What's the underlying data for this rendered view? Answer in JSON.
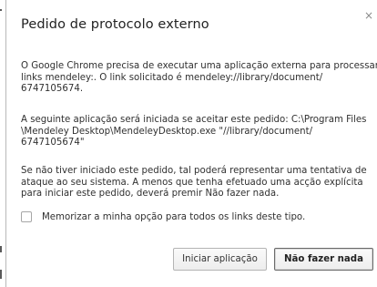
{
  "dialog": {
    "title": "Pedido de protocolo externo",
    "close_glyph": "×",
    "close_icon": "close-icon",
    "paragraph1": [
      "O Google Chrome precisa de executar uma aplicação externa para processar",
      "links mendeley:. O link solicitado é mendeley://library/document/",
      "6747105674."
    ],
    "paragraph2": [
      "A seguinte aplicação será iniciada se aceitar este pedido: C:\\Program Files",
      "\\Mendeley Desktop\\MendeleyDesktop.exe \"//library/document/",
      "6747105674\""
    ],
    "paragraph3": [
      "Se não tiver iniciado este pedido, tal poderá representar uma tentativa de",
      "ataque ao seu sistema. A menos que tenha efetuado uma acção explícita",
      "para iniciar este pedido, deverá premir Não fazer nada."
    ],
    "remember_checkbox": {
      "label": "Memorizar a minha opção para todos os links deste tipo.",
      "checked": false
    },
    "buttons": {
      "launch_label": "Iniciar aplicação",
      "cancel_label": "Não fazer nada"
    }
  }
}
